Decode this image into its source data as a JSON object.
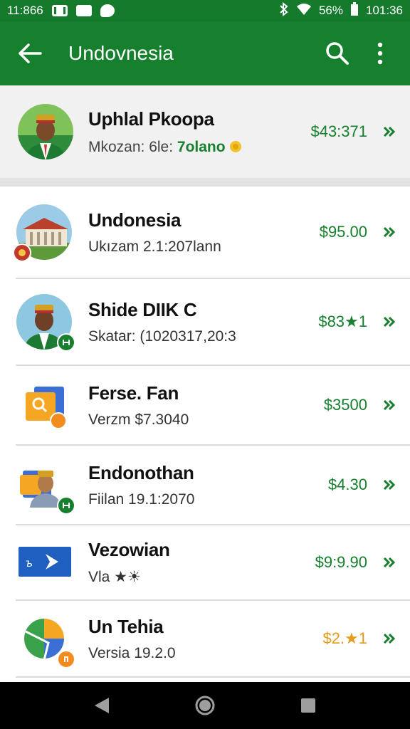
{
  "status_bar": {
    "time_left": "11:866",
    "battery": "56%",
    "time_right": "101:36"
  },
  "app_bar": {
    "title": "Undovnesia",
    "back_icon": "back-arrow-icon",
    "search_icon": "search-icon",
    "menu_icon": "more-vert-icon"
  },
  "featured": {
    "title": "Uphlal Pkoopa",
    "subtitle": "Mkozan: 6le:",
    "subtitle_accent": "7olano",
    "price": "$43:371",
    "accent_color": "#16802e"
  },
  "items": [
    {
      "title": "Undonesia",
      "subtitle": "Ukızam 2.1:207lann",
      "price": "$95.00",
      "price_color": "#16802e"
    },
    {
      "title": "Shide DIIK C",
      "subtitle": "Skatar: (1020317,20:3",
      "price": "$83★1",
      "price_color": "#16802e"
    },
    {
      "title": "Ferse. Fan",
      "subtitle": "Verzm $7.3040",
      "price": "$3500",
      "price_color": "#16802e"
    },
    {
      "title": "Endonothan",
      "subtitle": "Fiilan 19.1:2070",
      "price": "$4.30",
      "price_color": "#16802e"
    },
    {
      "title": "Vezowian",
      "subtitle": "Vla ★☀",
      "price": "$9:9.90",
      "price_color": "#16802e"
    },
    {
      "title": "Un Tehia",
      "subtitle": "Versia 19.2.0",
      "price": "$2.★1",
      "price_color": "#e69a1a"
    }
  ],
  "nav_bar": {
    "back_icon": "nav-back-icon",
    "home_icon": "nav-home-icon",
    "recents_icon": "nav-recents-icon"
  }
}
